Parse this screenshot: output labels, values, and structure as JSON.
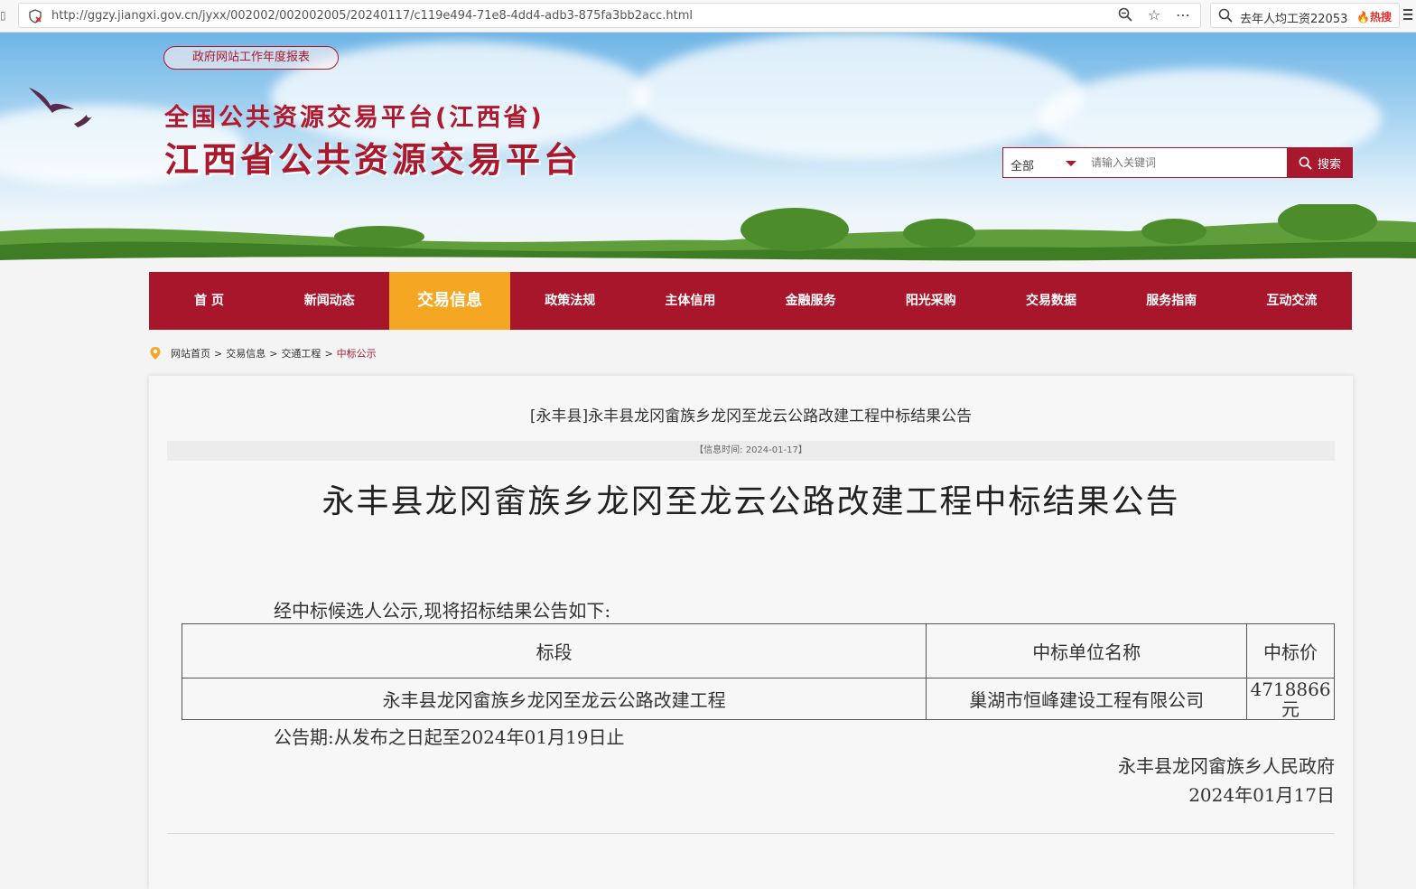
{
  "browser": {
    "url": "http://ggzy.jiangxi.gov.cn/jyxx/002002/002002005/20240117/c119e494-71e8-4dd4-adb3-875fa3bb2acc.html",
    "side_search_text": "去年人均工资22053",
    "hot_label": "热搜"
  },
  "header": {
    "report_label": "政府网站工作年度报表",
    "title_line1": "全国公共资源交易平台(江西省)",
    "title_line2": "江西省公共资源交易平台",
    "search": {
      "select_value": "全部",
      "placeholder": "请输入关键词",
      "button_label": "搜索"
    }
  },
  "nav": {
    "items": [
      {
        "label": "首 页"
      },
      {
        "label": "新闻动态"
      },
      {
        "label": "交易信息"
      },
      {
        "label": "政策法规"
      },
      {
        "label": "主体信用"
      },
      {
        "label": "金融服务"
      },
      {
        "label": "阳光采购"
      },
      {
        "label": "交易数据"
      },
      {
        "label": "服务指南"
      },
      {
        "label": "互动交流"
      }
    ],
    "active": "交易信息"
  },
  "breadcrumb": {
    "items": [
      "网站首页",
      "交易信息",
      "交通工程"
    ],
    "separator": ">",
    "current": "中标公示"
  },
  "article": {
    "short_title": "[永丰县]永丰县龙冈畲族乡龙冈至龙云公路改建工程中标结果公告",
    "info_time": "【信息时间: 2024-01-17】",
    "main_title": "永丰县龙冈畲族乡龙冈至龙云公路改建工程中标结果公告",
    "intro": "经中标候选人公示,现将招标结果公告如下:",
    "table": {
      "headers": [
        "标段",
        "中标单位名称",
        "中标价"
      ],
      "rows": [
        [
          "永丰县龙冈畲族乡龙冈至龙云公路改建工程",
          "巢湖市恒峰建设工程有限公司",
          "4718866元"
        ]
      ]
    },
    "period": "公告期:从发布之日起至2024年01月19日止",
    "issuer": "永丰县龙冈畲族乡人民政府",
    "date": "2024年01月17日"
  },
  "colors": {
    "brand_red": "#a8162b",
    "active_orange": "#f5a623"
  }
}
